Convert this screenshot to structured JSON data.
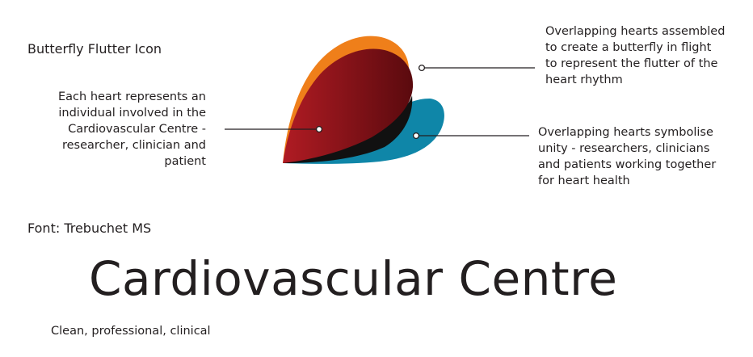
{
  "icon_section": {
    "title": "Butterfly Flutter Icon"
  },
  "annotations": {
    "left": [
      "Each heart represents an",
      "individual involved in the",
      "Cardiovascular Centre -",
      "researcher, clinician and",
      "patient"
    ],
    "top_right": [
      "Overlapping hearts assembled",
      "to create a butterfly in flight",
      "to represent the flutter of the",
      "heart rhythm"
    ],
    "bottom_right": [
      "Overlapping hearts symbolise",
      "unity - researchers, clinicians",
      "and patients working together",
      "for heart health"
    ]
  },
  "font_section": {
    "label": "Font:  Trebuchet MS"
  },
  "wordmark": {
    "text": "Cardiovascular Centre",
    "tagline": "Clean, professional, clinical"
  },
  "colors": {
    "orange_heart": "#ef7f1a",
    "red_heart_light": "#b01b23",
    "red_heart_dark": "#5a0a0e",
    "blue_heart": "#0f86a8",
    "shadow": "#111111",
    "text": "#231f20"
  }
}
